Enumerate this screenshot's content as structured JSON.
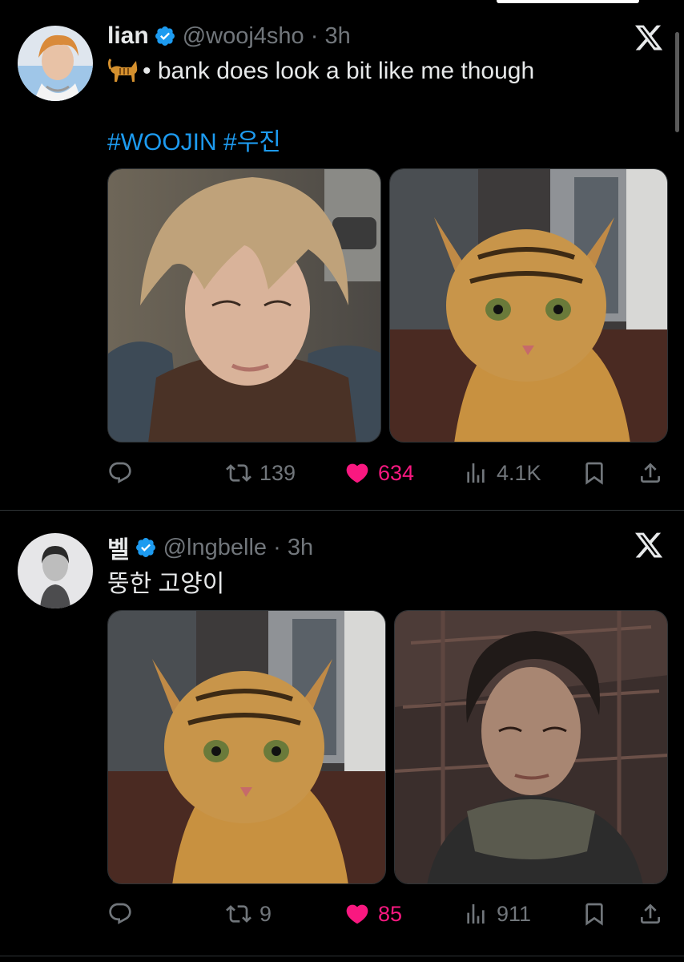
{
  "tweets": [
    {
      "name": "lian",
      "handle": "@wooj4sho",
      "time": "3h",
      "text_line1": "• bank does look a bit like me though",
      "hashtags": "#WOOJIN #우진",
      "icon_emoji": "cat-emoji-icon",
      "images": [
        "woojin-selfie-photo",
        "bengal-cat-photo"
      ],
      "stats": {
        "replies": "",
        "reposts": "139",
        "likes": "634",
        "views": "4.1K"
      },
      "liked": true
    },
    {
      "name": "벨",
      "handle": "@lngbelle",
      "time": "3h",
      "text_line1": "뚱한 고양이",
      "images": [
        "bengal-cat-photo",
        "woojin-portrait-photo"
      ],
      "stats": {
        "replies": "",
        "reposts": "9",
        "likes": "85",
        "views": "911"
      },
      "liked": true
    }
  ],
  "colors": {
    "background": "#000000",
    "text": "#e7e9ea",
    "muted": "#71767b",
    "link": "#1d9bf0",
    "like": "#f91880",
    "verified": "#1d9bf0"
  }
}
